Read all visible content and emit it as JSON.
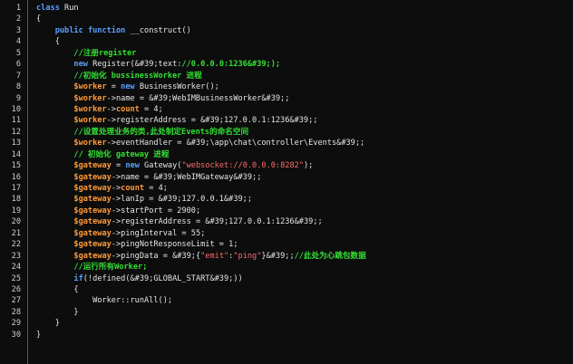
{
  "lines": [
    [
      {
        "t": "class",
        "c": "kw"
      },
      {
        "t": " Run"
      }
    ],
    [
      {
        "t": "{"
      }
    ],
    [
      {
        "t": "    "
      },
      {
        "t": "public",
        "c": "kw"
      },
      {
        "t": " "
      },
      {
        "t": "function",
        "c": "kw"
      },
      {
        "t": " __construct()"
      }
    ],
    [
      {
        "t": "    {"
      }
    ],
    [
      {
        "t": "        "
      },
      {
        "t": "//注册register",
        "c": "cm"
      }
    ],
    [
      {
        "t": "        "
      },
      {
        "t": "new",
        "c": "kw"
      },
      {
        "t": " Register(&#39;text:"
      },
      {
        "t": "//0.0.0.0:1236&#39;);",
        "c": "cm"
      }
    ],
    [
      {
        "t": "        "
      },
      {
        "t": "//初始化 bussinessWorker 进程",
        "c": "cm"
      }
    ],
    [
      {
        "t": "        "
      },
      {
        "t": "$worker",
        "c": "var"
      },
      {
        "t": " = "
      },
      {
        "t": "new",
        "c": "kw"
      },
      {
        "t": " BusinessWorker();"
      }
    ],
    [
      {
        "t": "        "
      },
      {
        "t": "$worker",
        "c": "var"
      },
      {
        "t": "->name = &#39;WebIMBusinessWorker&#39;;"
      }
    ],
    [
      {
        "t": "        "
      },
      {
        "t": "$worker",
        "c": "var"
      },
      {
        "t": "->"
      },
      {
        "t": "count",
        "c": "var"
      },
      {
        "t": " = 4;"
      }
    ],
    [
      {
        "t": "        "
      },
      {
        "t": "$worker",
        "c": "var"
      },
      {
        "t": "->registerAddress = &#39;127.0.0.1:1236&#39;;"
      }
    ],
    [
      {
        "t": "        "
      },
      {
        "t": "//设置处理业务的类,此处制定Events的命名空间",
        "c": "cm"
      }
    ],
    [
      {
        "t": "        "
      },
      {
        "t": "$worker",
        "c": "var"
      },
      {
        "t": "->eventHandler = &#39;\\app\\chat\\controller\\Events&#39;;"
      }
    ],
    [
      {
        "t": "        "
      },
      {
        "t": "// 初始化 gateway 进程",
        "c": "cm"
      }
    ],
    [
      {
        "t": "        "
      },
      {
        "t": "$gateway",
        "c": "var"
      },
      {
        "t": " = "
      },
      {
        "t": "new",
        "c": "kw"
      },
      {
        "t": " Gateway("
      },
      {
        "t": "\"websocket://0.0.0.0:8282\"",
        "c": "str"
      },
      {
        "t": ");"
      }
    ],
    [
      {
        "t": "        "
      },
      {
        "t": "$gateway",
        "c": "var"
      },
      {
        "t": "->name = &#39;WebIMGateway&#39;;"
      }
    ],
    [
      {
        "t": "        "
      },
      {
        "t": "$gateway",
        "c": "var"
      },
      {
        "t": "->"
      },
      {
        "t": "count",
        "c": "var"
      },
      {
        "t": " = 4;"
      }
    ],
    [
      {
        "t": "        "
      },
      {
        "t": "$gateway",
        "c": "var"
      },
      {
        "t": "->lanIp = &#39;127.0.0.1&#39;;"
      }
    ],
    [
      {
        "t": "        "
      },
      {
        "t": "$gateway",
        "c": "var"
      },
      {
        "t": "->startPort = 2900;"
      }
    ],
    [
      {
        "t": "        "
      },
      {
        "t": "$gateway",
        "c": "var"
      },
      {
        "t": "->registerAddress = &#39;127.0.0.1:1236&#39;;"
      }
    ],
    [
      {
        "t": "        "
      },
      {
        "t": "$gateway",
        "c": "var"
      },
      {
        "t": "->pingInterval = 55;"
      }
    ],
    [
      {
        "t": "        "
      },
      {
        "t": "$gateway",
        "c": "var"
      },
      {
        "t": "->pingNotResponseLimit = 1;"
      }
    ],
    [
      {
        "t": "        "
      },
      {
        "t": "$gateway",
        "c": "var"
      },
      {
        "t": "->pingData = &#39;{"
      },
      {
        "t": "\"emit\"",
        "c": "str"
      },
      {
        "t": ":"
      },
      {
        "t": "\"ping\"",
        "c": "str"
      },
      {
        "t": "}&#39;;"
      },
      {
        "t": "//此处为心跳包数据",
        "c": "cm"
      }
    ],
    [
      {
        "t": "        "
      },
      {
        "t": "//运行所有Worker;",
        "c": "cm"
      }
    ],
    [
      {
        "t": "        "
      },
      {
        "t": "if",
        "c": "kw"
      },
      {
        "t": "(!defined(&#39;GLOBAL_START&#39;))"
      }
    ],
    [
      {
        "t": "        {"
      }
    ],
    [
      {
        "t": "            Worker::runAll();"
      }
    ],
    [
      {
        "t": "        }"
      }
    ],
    [
      {
        "t": "    }"
      }
    ],
    [
      {
        "t": "}"
      }
    ]
  ],
  "colors": {
    "background": "#0d0d0d",
    "keyword": "#5aa0ff",
    "comment": "#34e034",
    "variable": "#ff9a3a",
    "string": "#ff6b6b",
    "text": "#e6e6e6",
    "line_number": "#cfcfcf"
  }
}
